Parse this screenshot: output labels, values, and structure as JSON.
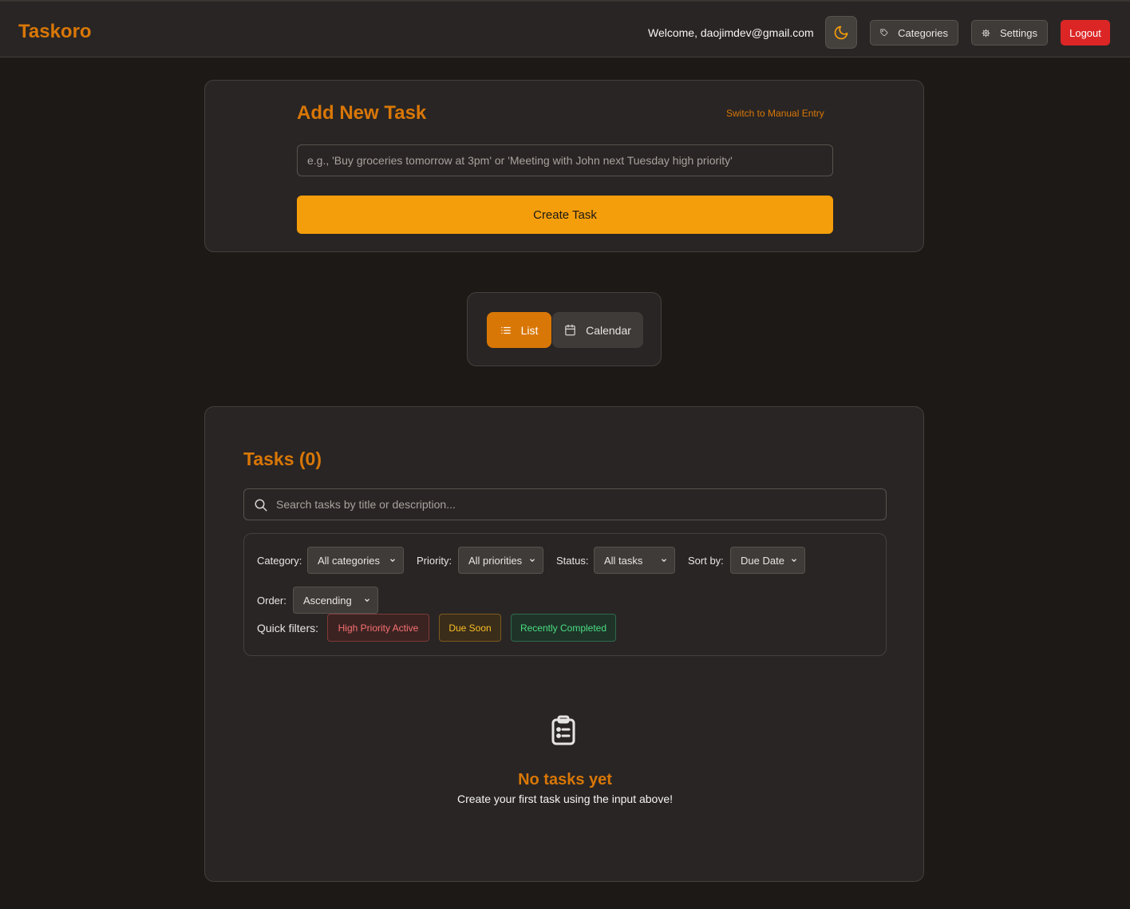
{
  "header": {
    "brand": "Taskoro",
    "welcome": "Welcome, daojimdev@gmail.com",
    "theme_icon": "moon-icon",
    "categories_label": "Categories",
    "settings_label": "Settings",
    "logout_label": "Logout"
  },
  "add_task": {
    "title": "Add New Task",
    "switch_label": "Switch to Manual Entry",
    "placeholder": "e.g., 'Buy groceries tomorrow at 3pm' or 'Meeting with John next Tuesday high priority'",
    "create_label": "Create Task"
  },
  "view_toggle": {
    "list_label": "List",
    "calendar_label": "Calendar",
    "active": "List"
  },
  "tasks": {
    "title": "Tasks (0)",
    "search_placeholder": "Search tasks by title or description...",
    "filters": {
      "category_label": "Category:",
      "category_value": "All categories",
      "priority_label": "Priority:",
      "priority_value": "All priorities",
      "status_label": "Status:",
      "status_value": "All tasks",
      "sort_label": "Sort by:",
      "sort_value": "Due Date",
      "order_label": "Order:",
      "order_value": "Ascending"
    },
    "quick_filters": {
      "label": "Quick filters:",
      "high_priority": "High Priority Active",
      "due_soon": "Due Soon",
      "recently_completed": "Recently Completed"
    },
    "empty": {
      "icon": "clipboard-list-icon",
      "title": "No tasks yet",
      "subtitle": "Create your first task using the input above!"
    }
  },
  "colors": {
    "accent": "#d97706",
    "primary_button": "#f59e0b",
    "danger": "#dc2626",
    "background": "#1c1917",
    "surface": "#292524"
  }
}
